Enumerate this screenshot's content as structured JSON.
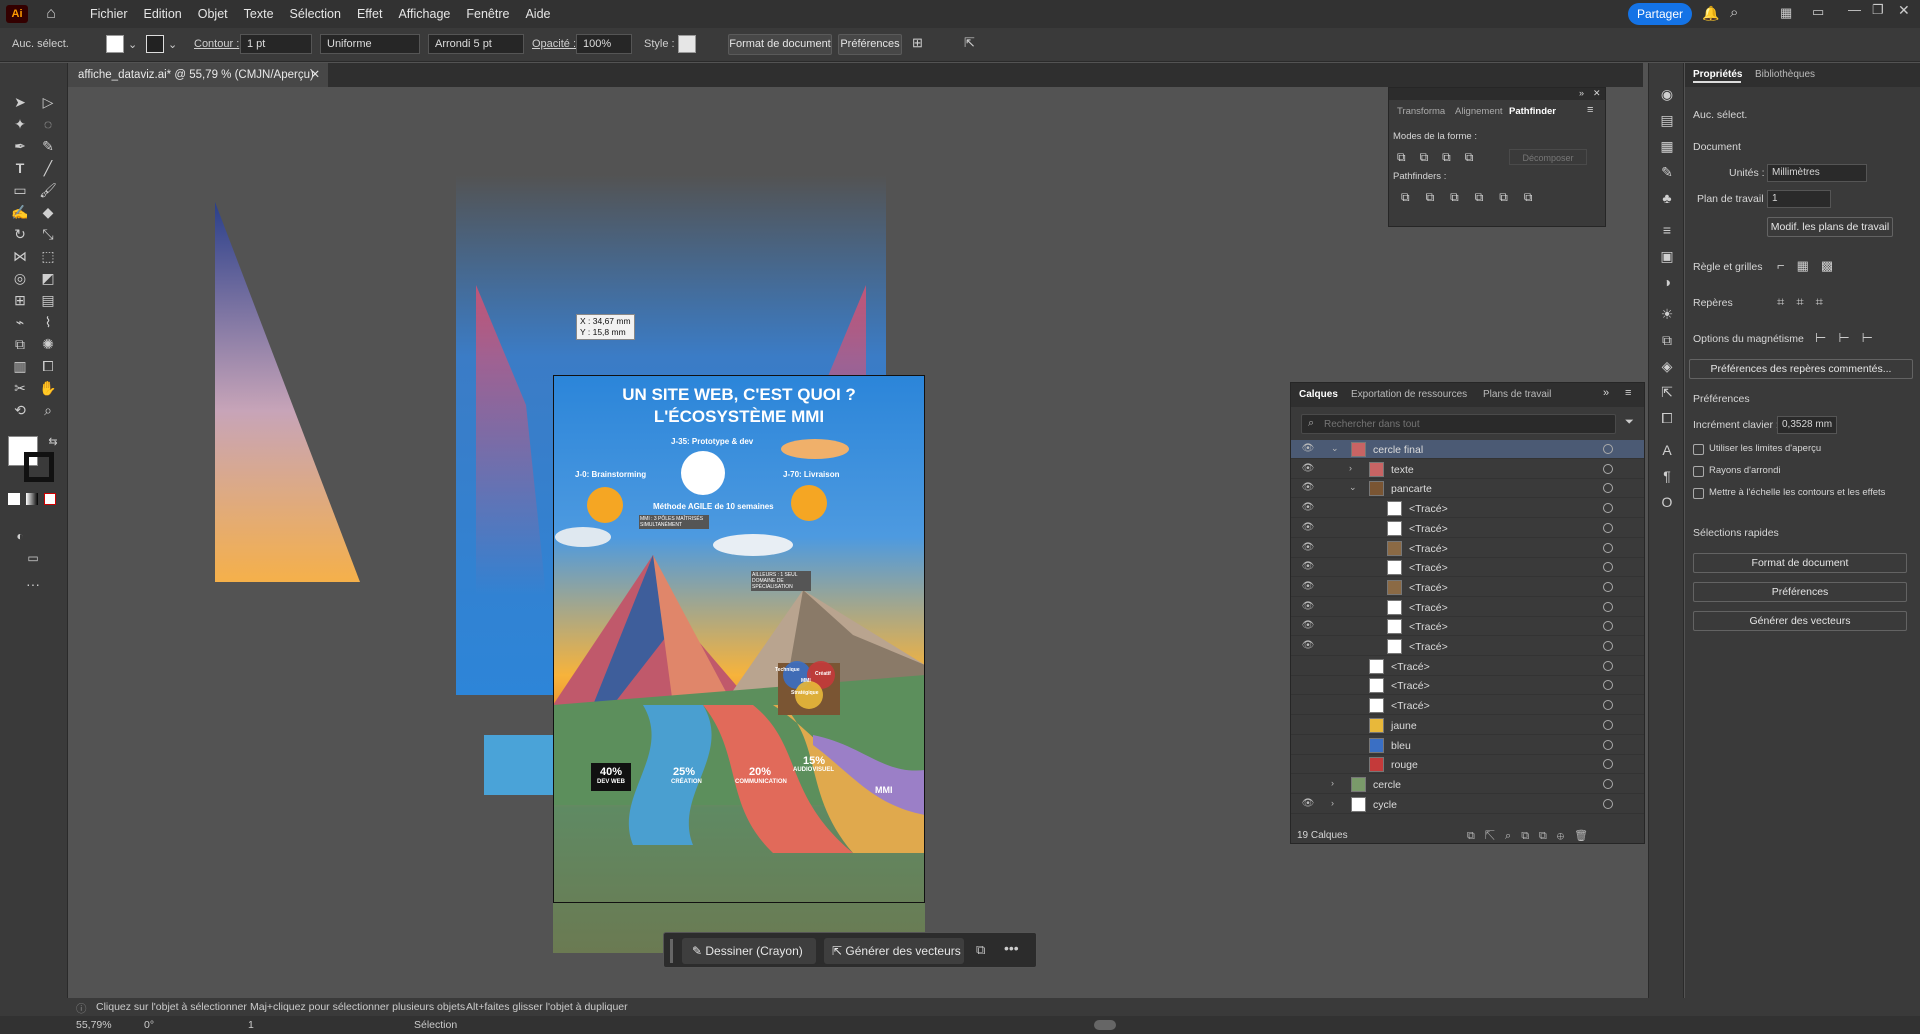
{
  "app": {
    "logo": "Ai",
    "home_icon": "home-icon"
  },
  "menu": [
    "Fichier",
    "Edition",
    "Objet",
    "Texte",
    "Sélection",
    "Effet",
    "Affichage",
    "Fenêtre",
    "Aide"
  ],
  "share_label": "Partager",
  "control": {
    "selection": "Auc. sélect.",
    "stroke_label": "Contour :",
    "stroke_value": "1 pt",
    "profile": "Uniforme",
    "brush": "Arrondi 5 pt",
    "opacity_label": "Opacité :",
    "opacity_value": "100%",
    "style_label": "Style :",
    "doc_format_btn": "Format de document",
    "prefs_btn": "Préférences"
  },
  "document_tab": "affiche_dataviz.ai* @ 55,79 % (CMJN/Aperçu)",
  "tooltip": {
    "x": "X : 34,67 mm",
    "y": "Y : 15,8 mm"
  },
  "poster": {
    "title1": "UN SITE WEB, C'EST QUOI ?",
    "title2": "L'ÉCOSYSTÈME MMI",
    "j35": "J-35: Prototype & dev",
    "j0": "J-0: Brainstorming",
    "j70": "J-70: Livraison",
    "method": "Méthode AGILE de 10 semaines",
    "poles": "MMI : 3 PÔLES MAÎTRISÉS SIMULTANÉMENT",
    "spec": "AILLEURS : 1 SEUL DOMAINE DE SPÉCIALISATION",
    "venn": [
      "Technique",
      "Créatif",
      "MMI",
      "Stratégique"
    ],
    "stats": [
      {
        "pct": "40%",
        "label": "DEV WEB"
      },
      {
        "pct": "25%",
        "label": "CRÉATION"
      },
      {
        "pct": "20%",
        "label": "COMMUNICATION"
      },
      {
        "pct": "15%",
        "label": "AUDIOVISUEL"
      }
    ],
    "brand": "MMI"
  },
  "pathfinder": {
    "tabs": [
      "Transforma",
      "Alignement",
      "Pathfinder"
    ],
    "modes_label": "Modes de la forme :",
    "decompose": "Décomposer",
    "pathfinders_label": "Pathfinders :"
  },
  "layers_panel": {
    "tabs": [
      "Calques",
      "Exportation de ressources",
      "Plans de travail"
    ],
    "search_placeholder": "Rechercher dans tout",
    "rows": [
      {
        "name": "cercle final",
        "indent": 0,
        "eye": true,
        "sel": true,
        "thumb": "#c86464"
      },
      {
        "name": "texte",
        "indent": 1,
        "eye": true,
        "thumb": "#c86464"
      },
      {
        "name": "pancarte",
        "indent": 1,
        "eye": true,
        "thumb": "#7a5533"
      },
      {
        "name": "<Tracé>",
        "indent": 2,
        "eye": true,
        "thumb": "#ffffff"
      },
      {
        "name": "<Tracé>",
        "indent": 2,
        "eye": true,
        "thumb": "#ffffff"
      },
      {
        "name": "<Tracé>",
        "indent": 2,
        "eye": true,
        "thumb": "#8b6a45"
      },
      {
        "name": "<Tracé>",
        "indent": 2,
        "eye": true,
        "thumb": "#ffffff"
      },
      {
        "name": "<Tracé>",
        "indent": 2,
        "eye": true,
        "thumb": "#8b6a45"
      },
      {
        "name": "<Tracé>",
        "indent": 2,
        "eye": true,
        "thumb": "#ffffff"
      },
      {
        "name": "<Tracé>",
        "indent": 2,
        "eye": true,
        "thumb": "#ffffff"
      },
      {
        "name": "<Tracé>",
        "indent": 2,
        "eye": true,
        "thumb": "#ffffff"
      },
      {
        "name": "<Tracé>",
        "indent": 1,
        "eye": false,
        "thumb": "#ffffff"
      },
      {
        "name": "<Tracé>",
        "indent": 1,
        "eye": false,
        "thumb": "#ffffff"
      },
      {
        "name": "<Tracé>",
        "indent": 1,
        "eye": false,
        "thumb": "#ffffff"
      },
      {
        "name": "jaune",
        "indent": 1,
        "eye": false,
        "thumb": "#e8b83a"
      },
      {
        "name": "bleu",
        "indent": 1,
        "eye": false,
        "thumb": "#3a6fc4"
      },
      {
        "name": "rouge",
        "indent": 1,
        "eye": false,
        "thumb": "#c43a3a"
      },
      {
        "name": "cercle",
        "indent": 0,
        "eye": false,
        "thumb": "#7a9a6a"
      },
      {
        "name": "cycle",
        "indent": 0,
        "eye": true,
        "thumb": "#ffffff"
      }
    ],
    "count": "19 Calques"
  },
  "properties": {
    "tabs": [
      "Propriétés",
      "Bibliothèques"
    ],
    "selection": "Auc. sélect.",
    "document": "Document",
    "units_label": "Unités :",
    "units_value": "Millimètres",
    "artboard_label": "Plan de travail :",
    "artboard_value": "1",
    "edit_artboards_btn": "Modif. les plans de travail",
    "rulers": "Règle et grilles",
    "guides": "Repères",
    "snap": "Options du magnétisme",
    "guide_prefs_btn": "Préférences des repères commentés...",
    "preferences": "Préférences",
    "keyboard_inc_label": "Incrément clavier :",
    "keyboard_inc_value": "0,3528 mm",
    "chk1": "Utiliser les limites d'aperçu",
    "chk2": "Rayons d'arrondi",
    "chk3": "Mettre à l'échelle les contours et les effets",
    "quick": "Sélections rapides",
    "qbtn1": "Format de document",
    "qbtn2": "Préférences",
    "qbtn3": "Générer des vecteurs"
  },
  "context_bar": {
    "draw": "Dessiner (Crayon)",
    "generate": "Générer des vecteurs"
  },
  "status": {
    "hint1": "Cliquez sur l'objet à sélectionner",
    "hint2": "Maj+cliquez pour sélectionner plusieurs objets",
    "hint3": "Alt+faites glisser l'objet à dupliquer",
    "zoom": "55,79%",
    "angle": "0°",
    "page": "1",
    "mode": "Sélection"
  }
}
